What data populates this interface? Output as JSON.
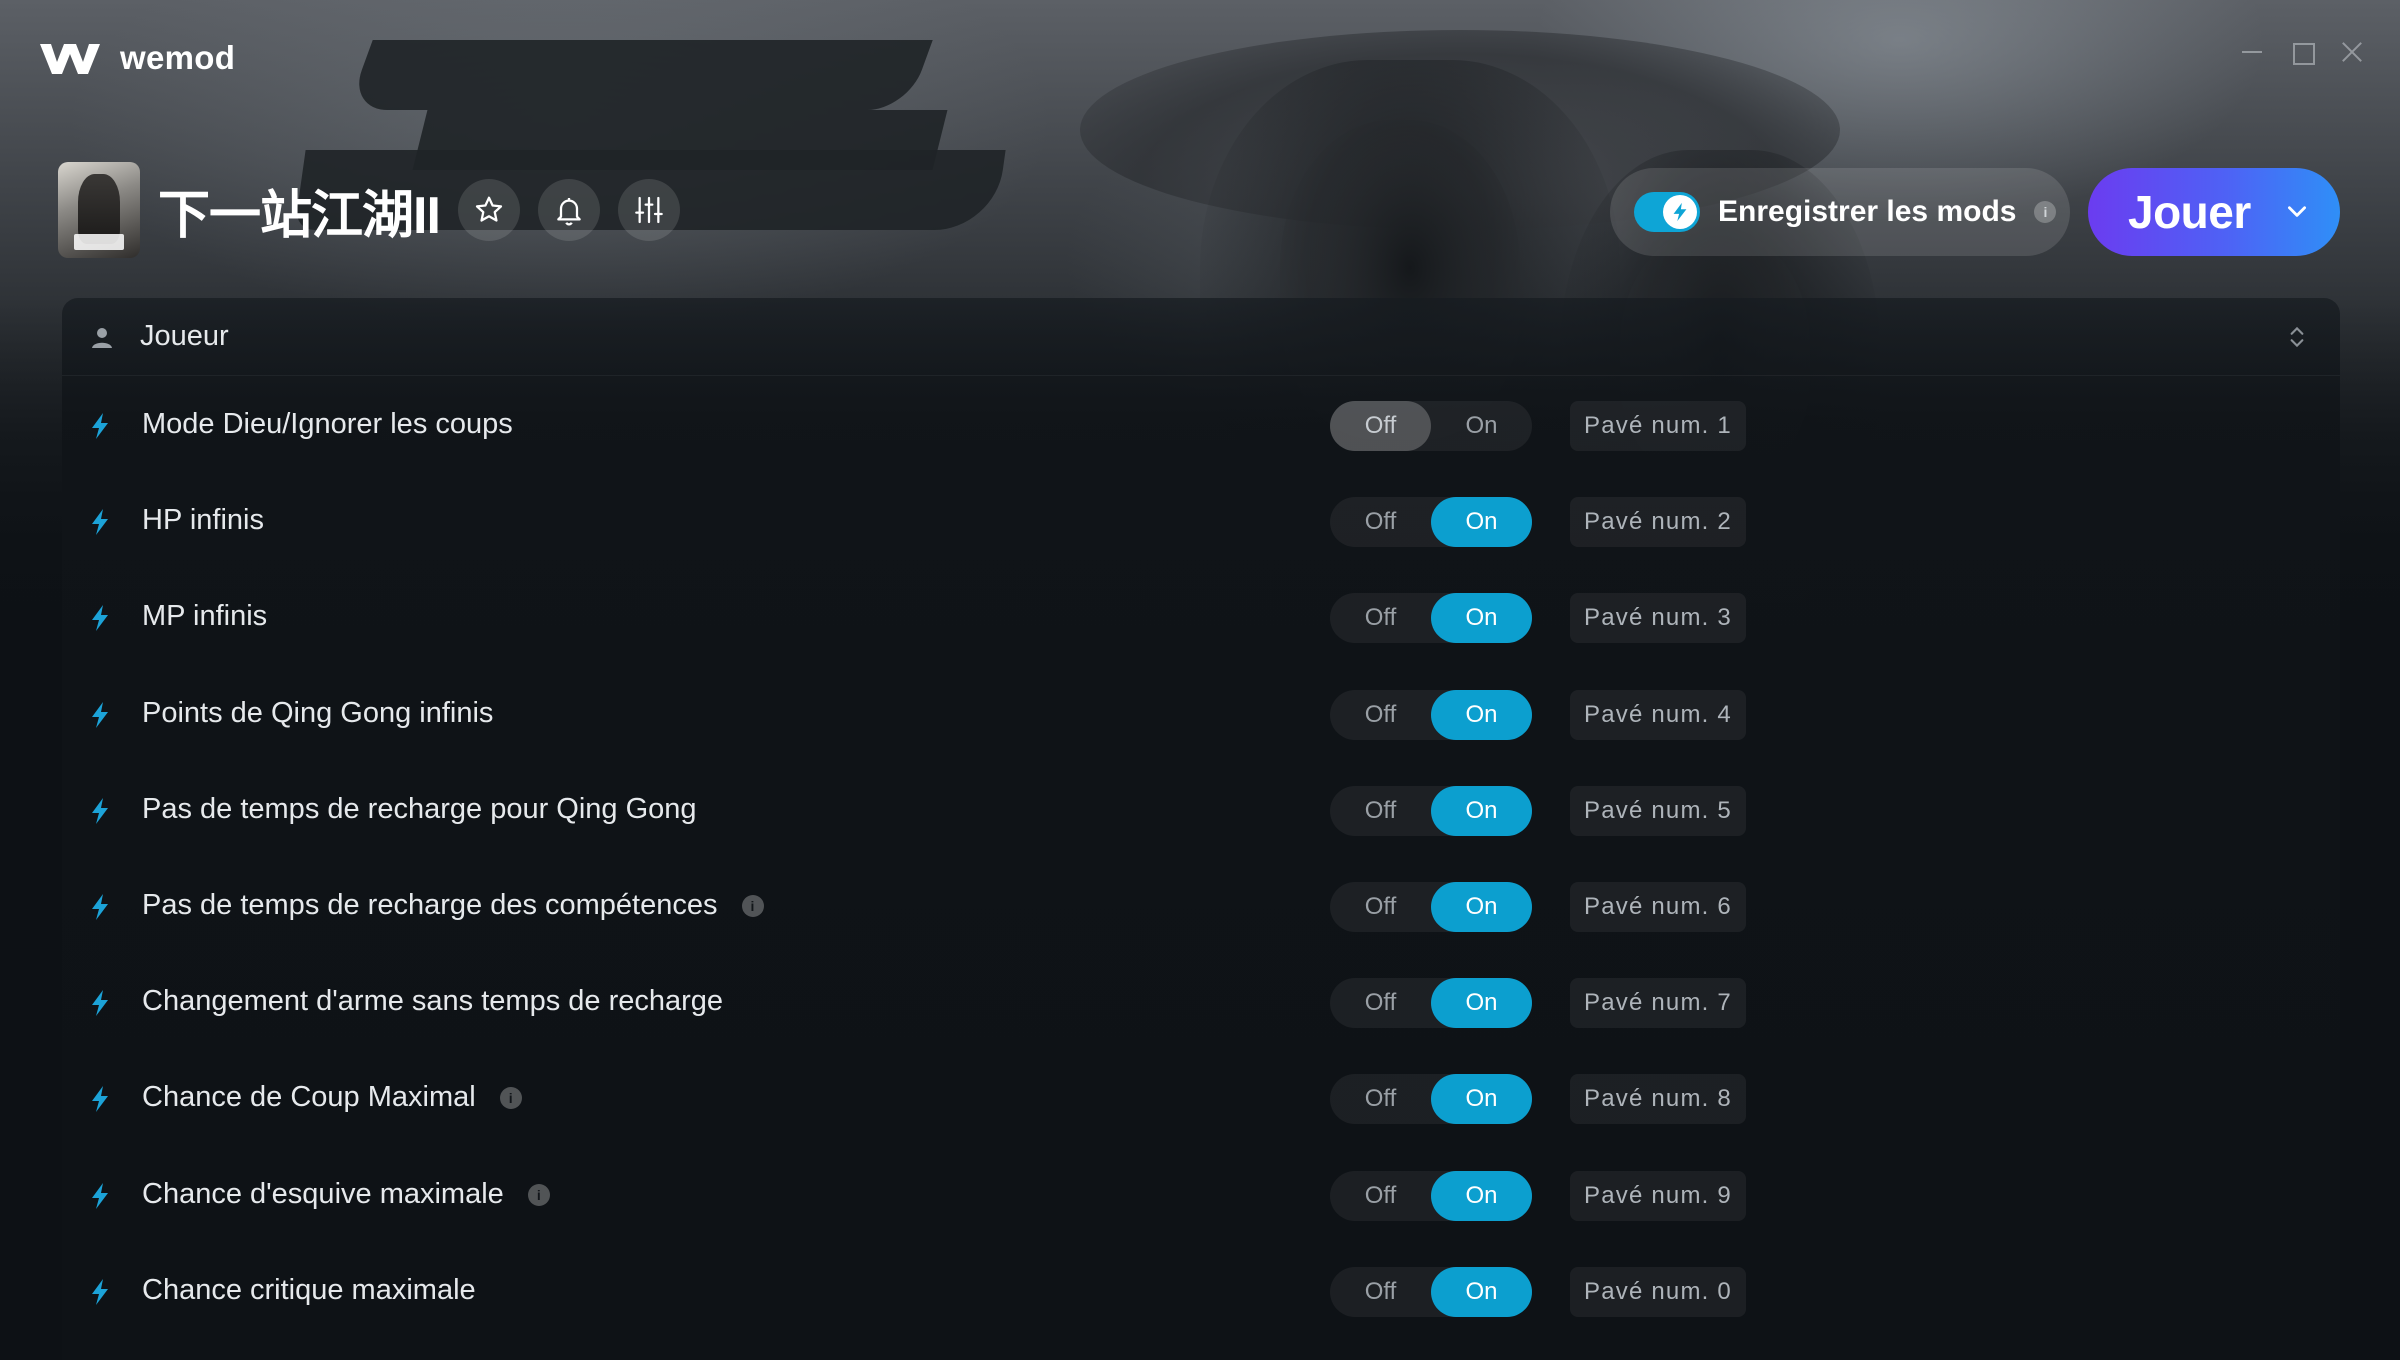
{
  "app": {
    "brand": "wemod"
  },
  "game": {
    "title": "下一站江湖II",
    "buttons": [
      "favorite-icon",
      "notification-bell-icon",
      "sliders-icon"
    ]
  },
  "header_actions": {
    "save_mods_label": "Enregistrer les mods",
    "save_mods_enabled": true,
    "info_glyph": "i",
    "play_label": "Jouer"
  },
  "colors": {
    "accent_on": "#0c9fcf",
    "play_gradient": [
      "#6b3cf0",
      "#2f8ff7"
    ],
    "bolt": "#1ca3d8"
  },
  "panel": {
    "category": "Joueur",
    "off_label": "Off",
    "on_label": "On",
    "mods": [
      {
        "name": "Mode Dieu/Ignorer les coups",
        "state": "off",
        "hotkey": "Pavé num. 1",
        "info": false
      },
      {
        "name": "HP infinis",
        "state": "on",
        "hotkey": "Pavé num. 2",
        "info": false
      },
      {
        "name": "MP infinis",
        "state": "on",
        "hotkey": "Pavé num. 3",
        "info": false
      },
      {
        "name": "Points de Qing Gong infinis",
        "state": "on",
        "hotkey": "Pavé num. 4",
        "info": false
      },
      {
        "name": "Pas de temps de recharge pour Qing Gong",
        "state": "on",
        "hotkey": "Pavé num. 5",
        "info": false
      },
      {
        "name": "Pas de temps de recharge des compétences",
        "state": "on",
        "hotkey": "Pavé num. 6",
        "info": true
      },
      {
        "name": "Changement d'arme sans temps de recharge",
        "state": "on",
        "hotkey": "Pavé num. 7",
        "info": false
      },
      {
        "name": "Chance de Coup Maximal",
        "state": "on",
        "hotkey": "Pavé num. 8",
        "info": true
      },
      {
        "name": "Chance d'esquive maximale",
        "state": "on",
        "hotkey": "Pavé num. 9",
        "info": true
      },
      {
        "name": "Chance critique maximale",
        "state": "on",
        "hotkey": "Pavé num. 0",
        "info": false
      }
    ]
  }
}
